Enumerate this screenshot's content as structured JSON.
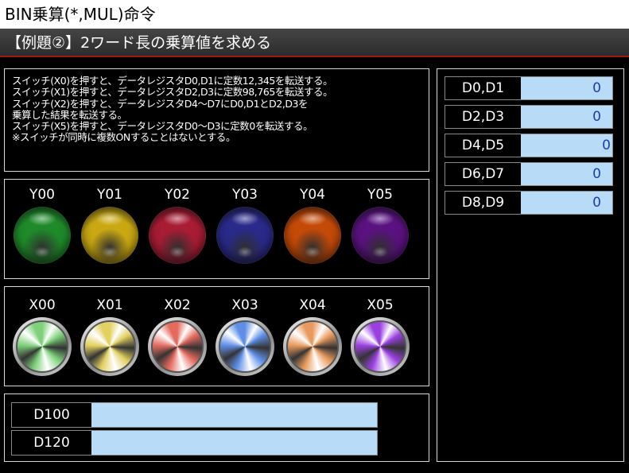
{
  "window": {
    "title": "BIN乗算(*,MUL)命令"
  },
  "header": {
    "subtitle": "【例題②】2ワード長の乗算値を求める"
  },
  "description": {
    "lines": [
      "スイッチ(X0)を押すと、データレジスタD0,D1に定数12,345を転送する。",
      "スイッチ(X1)を押すと、データレジスタD2,D3に定数98,765を転送する。",
      "スイッチ(X2)を押すと、データレジスタD4～D7にD0,D1とD2,D3を",
      "乗算した結果を転送する。",
      "スイッチ(X5)を押すと、データレジスタD0～D3に定数0を転送する。",
      "※スイッチが同時に複数ONすることはないとする。"
    ]
  },
  "lamps": [
    {
      "label": "Y00",
      "color": "#1f8a2a"
    },
    {
      "label": "Y01",
      "color": "#c9a812"
    },
    {
      "label": "Y02",
      "color": "#a81c34"
    },
    {
      "label": "Y03",
      "color": "#2a2a8a"
    },
    {
      "label": "Y04",
      "color": "#c44a08"
    },
    {
      "label": "Y05",
      "color": "#5a1280"
    }
  ],
  "switches": [
    {
      "label": "X00",
      "color": "#7ed07a"
    },
    {
      "label": "X01",
      "color": "#e2d060"
    },
    {
      "label": "X02",
      "color": "#e46a5e"
    },
    {
      "label": "X03",
      "color": "#5e8ee6"
    },
    {
      "label": "X04",
      "color": "#e89a5e"
    },
    {
      "label": "X05",
      "color": "#9a40e0"
    }
  ],
  "dregs": [
    {
      "name": "D100",
      "value": ""
    },
    {
      "name": "D120",
      "value": ""
    }
  ],
  "registers": [
    {
      "name": "D0,D1",
      "value": "0"
    },
    {
      "name": "D2,D3",
      "value": "0"
    },
    {
      "name": "D4,D5",
      "value": "0"
    },
    {
      "name": "D6,D7",
      "value": "0"
    },
    {
      "name": "D8,D9",
      "value": "0"
    }
  ]
}
